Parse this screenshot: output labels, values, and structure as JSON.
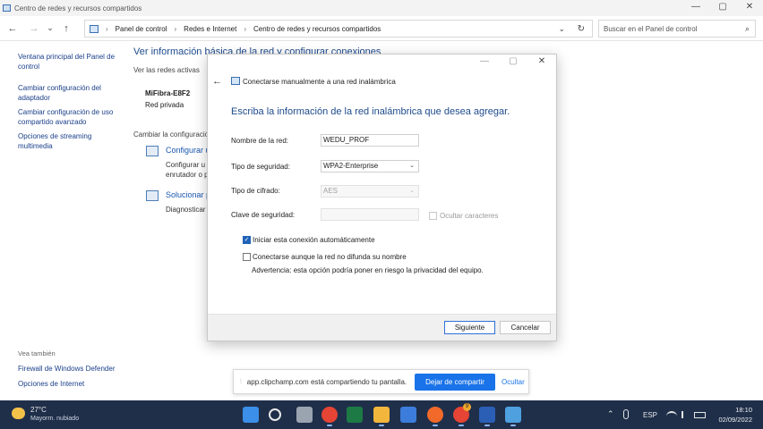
{
  "window": {
    "title": "Centro de redes y recursos compartidos",
    "controls": [
      "—",
      "▢",
      "✕"
    ]
  },
  "toolbar": {
    "back": "←",
    "forward": "→",
    "down": "⌄",
    "up": "↑"
  },
  "address": {
    "crumbs": [
      "Panel de control",
      "Redes e Internet",
      "Centro de redes y recursos compartidos"
    ],
    "sep": "›",
    "dropdown": "⌄",
    "refresh": "↻"
  },
  "search": {
    "placeholder": "Buscar en el Panel de control",
    "icon": "⌕"
  },
  "sidebar": {
    "items": [
      "Ventana principal del Panel de control",
      "Cambiar configuración del adaptador",
      "Cambiar configuración de uso compartido avanzado",
      "Opciones de streaming multimedia"
    ],
    "see_also": "Vea también",
    "see_also_items": [
      "Firewall de Windows Defender",
      "Opciones de Internet"
    ]
  },
  "main": {
    "title": "Ver información básica de la red y configurar conexiones",
    "active_networks": "Ver las redes activas",
    "network_name": "MiFibra-E8F2",
    "network_type": "Red privada",
    "change_config": "Cambiar la configuración",
    "option1_link": "Configurar u",
    "option1_desc1": "Configurar u",
    "option1_desc2": "enrutador o p",
    "option2_link": "Solucionar pr",
    "option2_desc": "Diagnosticar"
  },
  "dialog": {
    "back": "←",
    "caption": "Conectarse manualmente a una red inalámbrica",
    "heading": "Escriba la información de la red inalámbrica que desea agregar.",
    "labels": {
      "network_name": "Nombre de la red:",
      "security_type": "Tipo de seguridad:",
      "encryption": "Tipo de cifrado:",
      "security_key": "Clave de seguridad:"
    },
    "values": {
      "network_name": "WEDU_PROF",
      "security_type": "WPA2-Enterprise",
      "encryption": "AES",
      "security_key": ""
    },
    "hide_chars": "Ocultar caracteres",
    "auto_start": "Iniciar esta conexión automáticamente",
    "auto_start_checked": true,
    "connect_hidden": "Conectarse aunque la red no difunda su nombre",
    "connect_hidden_checked": false,
    "warning": "Advertencia: esta opción podría poner en riesgo la privacidad del equipo.",
    "next_button": "Siguiente",
    "cancel_button": "Cancelar",
    "check_mark": "✓",
    "dropdown_arrow": "⌄"
  },
  "share_bar": {
    "message": "app.clipchamp.com está compartiendo tu pantalla.",
    "grip": "⦙",
    "stop_button": "Dejar de compartir",
    "hide_button": "Ocultar"
  },
  "taskbar": {
    "temperature": "27°C",
    "weather": "Mayorm. nubiado",
    "language": "ESP",
    "time": "18:10",
    "date": "02/09/2022",
    "chrome_badge": "9",
    "tray_chevron": "⌃",
    "icon_colors": {
      "start": "#3b8fe8",
      "search": "#e9e9e9",
      "taskview": "#9aa3b0",
      "chrome": "#e64435",
      "excel": "#1d7a45",
      "explorer": "#f2b63c",
      "calendar": "#3c7ddb",
      "firefox": "#f26a2a",
      "chrome2": "#e64435",
      "word": "#2b5fb5",
      "rdp": "#4ea0df"
    }
  }
}
